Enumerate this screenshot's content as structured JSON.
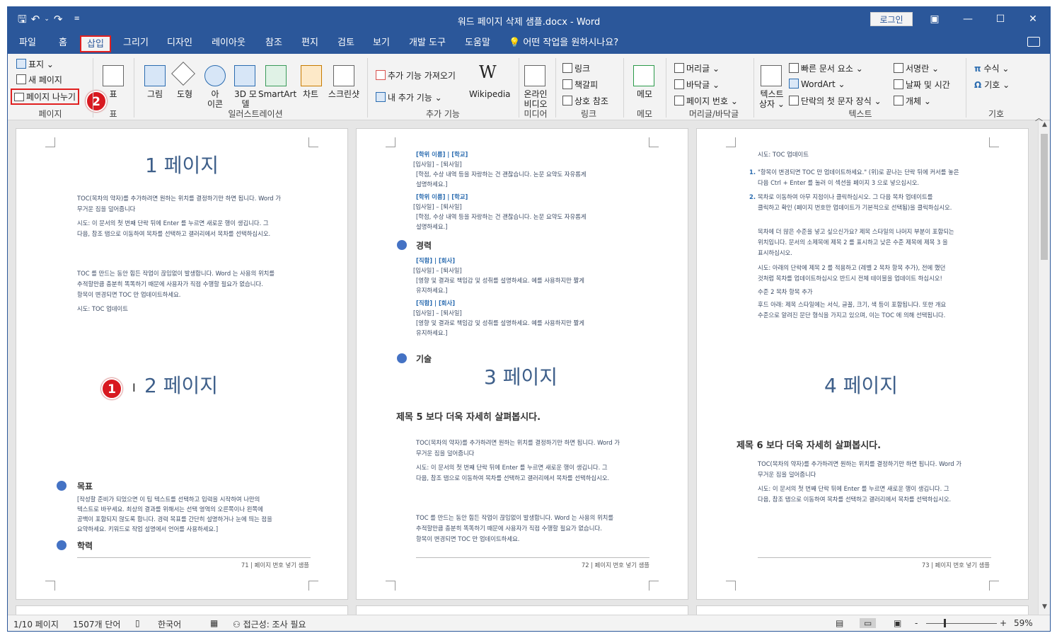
{
  "window": {
    "title": "워드 페이지 삭제 샘플.docx  -  Word",
    "login": "로그인"
  },
  "tabs": [
    {
      "label": "파일"
    },
    {
      "label": "홈"
    },
    {
      "label": "삽입"
    },
    {
      "label": "그리기"
    },
    {
      "label": "디자인"
    },
    {
      "label": "레이아웃"
    },
    {
      "label": "참조"
    },
    {
      "label": "편지"
    },
    {
      "label": "검토"
    },
    {
      "label": "보기"
    },
    {
      "label": "개발 도구"
    },
    {
      "label": "도움말"
    },
    {
      "label": "어떤 작업을 원하시나요?"
    }
  ],
  "ribbon": {
    "page_group": {
      "cover": "표지",
      "new_page": "새 페이지",
      "page_break": "페이지 나누기",
      "label": "페이지"
    },
    "table_group": {
      "table": "표",
      "label": "표"
    },
    "illust": {
      "picture": "그림",
      "shape": "도형",
      "icon1": "아",
      "icon2": "이콘",
      "model1": "3D 모",
      "model2": "델",
      "smartart": "SmartArt",
      "chart": "차트",
      "screenshot": "스크린샷",
      "label": "일러스트레이션"
    },
    "addins": {
      "get": "추가 기능 가져오기",
      "my": "내 추가 기능",
      "wikipedia": "Wikipedia",
      "label": "추가 기능"
    },
    "media": {
      "online1": "온라인",
      "online2": "비디오",
      "label": "미디어"
    },
    "links": {
      "link": "링크",
      "bookmark": "책갈피",
      "crossref": "상호 참조",
      "label": "링크"
    },
    "comments": {
      "memo": "메모",
      "label": "메모"
    },
    "headerfooter": {
      "header": "머리글",
      "footer": "바닥글",
      "pagenum": "페이지 번호",
      "label": "머리글/바닥글"
    },
    "text": {
      "textbox1": "텍스트",
      "textbox2": "상자",
      "quickparts": "빠른 문서 요소",
      "wordart": "WordArt",
      "dropcap": "단락의 첫 문자 장식",
      "signature": "서명란",
      "datetime": "날짜 및 시간",
      "object": "개체",
      "label": "텍스트"
    },
    "symbols": {
      "equation": "수식",
      "symbol": "기호",
      "label": "기호"
    }
  },
  "badges": {
    "one": "1",
    "two": "2"
  },
  "page1": {
    "title": "1 페이지",
    "p1a": "TOC(목차의 약자)를 추가하려면 원하는 위치를 결정하기만 하면 됩니다. Word 가",
    "p1b": "무거운 짐을 덜어줍니다",
    "p2a": "시도: 이 문서의 첫 번째 단락 뒤에 Enter 를 누르면 새로운 행이 생깁니다. 그",
    "p2b": "다음, 참조 탭으로 이동하여 목차를 선택하고 갤러리에서 목차를 선택하십시오.",
    "p3a": "TOC 를 만드는 동안 힘든 작업이 끊임없이 발생합니다. Word 는 사용의 위치를",
    "p3b": "추적할만큼 충분히 똑똑하기 때문에 사용자가 직접 수행할 필요가 없습니다.",
    "p3c": "항목이 변경되면 TOC 만 업데이트하세요.",
    "p4": "시도: TOC 업데이트",
    "title2": "2 페이지",
    "goal": "목표",
    "goal1": "[작성할 준비가 되었으면 이 팁 텍스트를 선택하고 입력을 시작하여 나만의",
    "goal2": "텍스트로 바꾸세요. 최상의 결과를 위해서는 선택 영역의 오른쪽이나 왼쪽에",
    "goal3": "공백이 포함되지 않도록 합니다. 경력 목표를 간단히 설명하거나 눈에 띄는 점을",
    "goal4": "요약하세요. 키워드로 작업 설명에서 언어를 사용하세요.]",
    "edu": "학력",
    "footer": "71 | 페이지 번호 넣기 샘플"
  },
  "page2": {
    "deg1": "[학위 이름] | [학교]",
    "dates": "[입사일] – [퇴사일]",
    "deg_desc1": "[학점, 수상 내역 등을 자랑하는 건 괜찮습니다. 논문 요약도 자유롭게",
    "deg_desc2": "설명하세요.]",
    "career": "경력",
    "job": "[직함] | [회사]",
    "job_desc1": "[영향 및 결과로 책임감 및 성취를 설명하세요. 예를 사용하지만 짧게",
    "job_desc2": "유지하세요.]",
    "skills": "기술",
    "title": "3 페이지",
    "heading": "제목 5 보다 더욱 자세히 살펴봅시다.",
    "footer": "72 | 페이지 번호 넣기 샘플"
  },
  "page3": {
    "intro": "시도: TOC 업데이트",
    "l1a": "\"항목이 변경되면 TOC 만 업데이트하세요.\" (위)로 끝나는 단락 뒤에 커서를 놓은",
    "l1b": "다음 Ctrl + Enter 를 눌러 이 섹션을 페이지 3 으로 넣으십시오.",
    "l2a": "목차로 이동하여 아무 지점이나 클릭하십시오. 그 다음 목차 업데이트를",
    "l2b": "클릭하고 확인 (페이지 번호만 업데이트가 기본적으로 선택됨)을 클릭하십시오.",
    "m1": "목차에 더 많은 수준을 넣고 싶으신가요? 제목 스타일의 나머지 부분이 포함되는",
    "m2": "위치입니다. 문서의 소제목에 제목 2 를 표시하고 낮은 수준 제목에 제목 3 을",
    "m3": "표시하십시오.",
    "t1": "시도: 아래의 단락에 제목 2 를 적용하고 (레벨 2 목차 항목 추가), 전에 했던",
    "t2": "것처럼 목차를 업데이트하십시오 반드시 전체 테이블을 업데이트 하십시오!",
    "t3": "수준 2 목차 항목 추가",
    "b1": "후드 아래: 제목 스타일에는 서식, 글꼴, 크기, 색 등이 포함됩니다. 또한 개요",
    "b2": "수준으로 알려진 문단 형식을 가지고 있으며, 이는 TOC 에 의해 선택됩니다.",
    "title": "4 페이지",
    "heading": "제목 6 보다 더욱 자세히 살펴봅시다.",
    "footer": "73 | 페이지 번호 넣기 샘플"
  },
  "status": {
    "pages": "1/10 페이지",
    "words": "1507개 단어",
    "lang": "한국어",
    "access": "접근성: 조사 필요",
    "zoom_minus": "-",
    "zoom_plus": "+",
    "zoom": "59%"
  },
  "colors": {
    "accent": "#2b579a",
    "highlight": "#e02020",
    "heading_blue": "#3e5f8a"
  }
}
